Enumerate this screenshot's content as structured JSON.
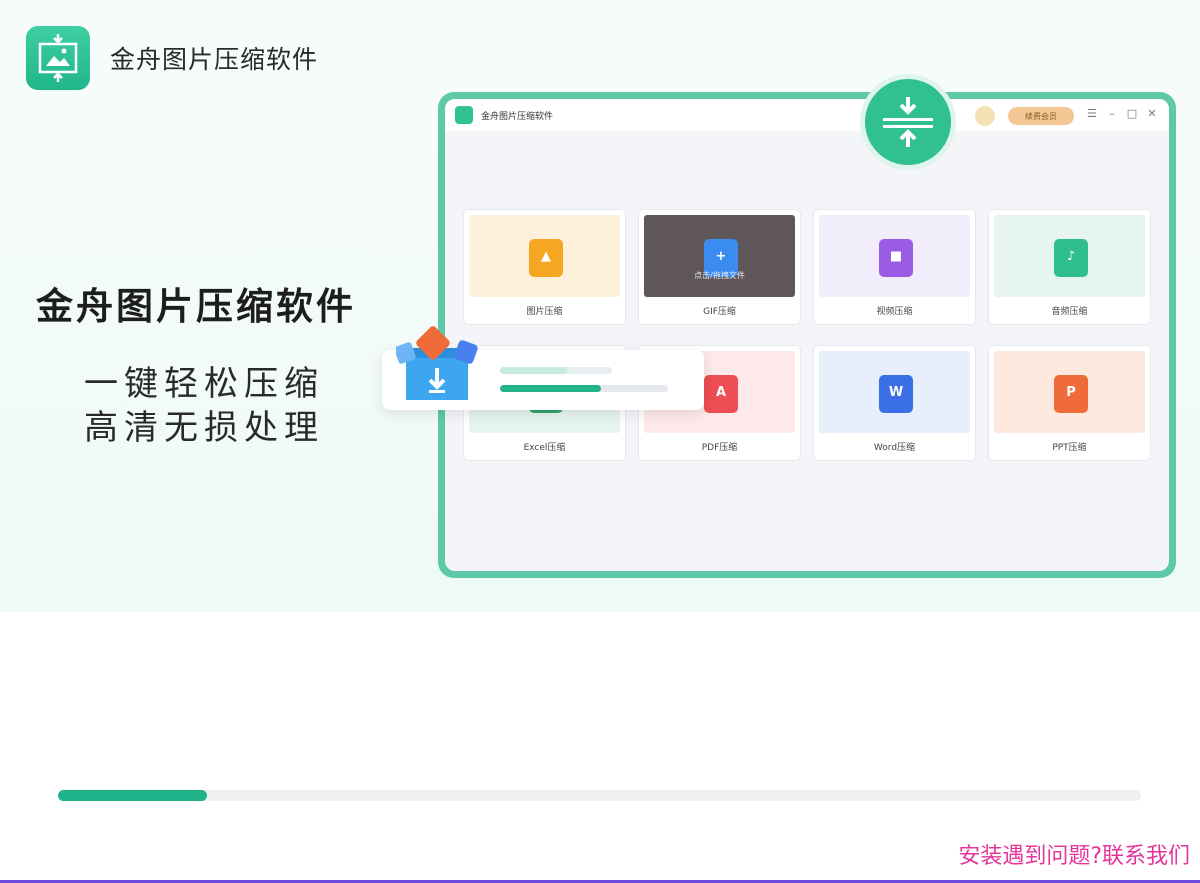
{
  "app": {
    "name": "金舟图片压缩软件",
    "logo_icon": "image-compress-icon"
  },
  "hero": {
    "title": "金舟图片压缩软件",
    "line1": "一键轻松压缩",
    "line2": "高清无损处理"
  },
  "mock": {
    "window_title": "金舟图片压缩软件",
    "vip_label": "续费会员",
    "cards": [
      {
        "label": "图片压缩",
        "thumb": "#fdf1dc",
        "icon": "#f5a623",
        "glyph": "▲"
      },
      {
        "label": "GIF压缩",
        "thumb": "#5e5658",
        "icon": "#3a8cf0",
        "glyph": "+"
      },
      {
        "label": "视频压缩",
        "thumb": "#f2edfb",
        "icon": "#9b5ce5",
        "glyph": "■"
      },
      {
        "label": "音频压缩",
        "thumb": "#e6f5ee",
        "icon": "#2fbf8f",
        "glyph": "♪"
      },
      {
        "label": "Excel压缩",
        "thumb": "#e6f5ee",
        "icon": "#2fa66f",
        "glyph": "X"
      },
      {
        "label": "PDF压缩",
        "thumb": "#fde9e9",
        "icon": "#ee4d55",
        "glyph": "A"
      },
      {
        "label": "Word压缩",
        "thumb": "#e7effc",
        "icon": "#3a6fe8",
        "glyph": "W"
      },
      {
        "label": "PPT压缩",
        "thumb": "#fde9df",
        "icon": "#f06b3a",
        "glyph": "P"
      }
    ],
    "active_text": "点击/拖拽文件",
    "upload_progress": 0.6,
    "file_progress": 0.6
  },
  "install": {
    "progress": 0.138
  },
  "help_text": "安装遇到问题?联系我们",
  "colors": {
    "accent": "#20b38a",
    "link": "#e5359b",
    "bottom_line": "#6f4be0"
  }
}
